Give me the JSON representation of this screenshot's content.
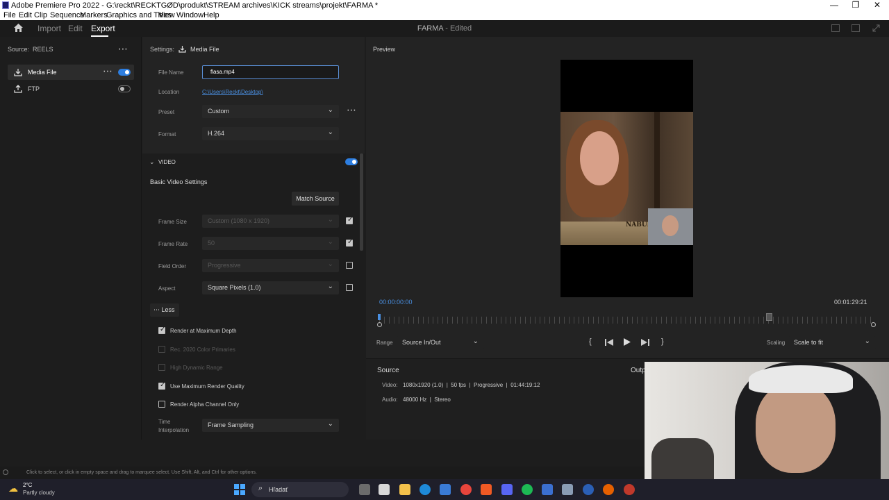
{
  "window": {
    "title": "Adobe Premiere Pro 2022 - G:\\reckt\\RECKTGØD\\produkt\\STREAM archives\\KICK streams\\projekt\\FARMA *",
    "controls": [
      "—",
      "❐",
      "✕"
    ]
  },
  "menu": [
    "File",
    "Edit",
    "Clip",
    "Sequence",
    "Markers",
    "Graphics and Titles",
    "View",
    "Window",
    "Help"
  ],
  "header": {
    "tabs": [
      "Import",
      "Edit",
      "Export"
    ],
    "active_tab": "Export",
    "project": "FARMA",
    "project_status": "- Edited"
  },
  "source_panel": {
    "label": "Source:",
    "value": "REELS",
    "destinations": [
      {
        "name": "Media File",
        "enabled": true
      },
      {
        "name": "FTP",
        "enabled": false
      }
    ]
  },
  "settings": {
    "label": "Settings:",
    "target": "Media File",
    "file_name_label": "File Name",
    "file_name": "flasa.mp4",
    "location_label": "Location",
    "location": "C:\\Users\\Reckt\\Desktop\\",
    "preset_label": "Preset",
    "preset": "Custom",
    "format_label": "Format",
    "format": "H.264"
  },
  "video": {
    "section_label": "VIDEO",
    "basic_title": "Basic Video Settings",
    "match_source": "Match Source",
    "frame_size_label": "Frame Size",
    "frame_size": "Custom (1080 x 1920)",
    "frame_rate_label": "Frame Rate",
    "frame_rate": "50",
    "field_order_label": "Field Order",
    "field_order": "Progressive",
    "aspect_label": "Aspect",
    "aspect": "Square Pixels (1.0)",
    "less_button": "Less",
    "options": [
      {
        "label": "Render at Maximum Depth",
        "checked": true,
        "disabled": false
      },
      {
        "label": "Rec. 2020 Color Primaries",
        "checked": false,
        "disabled": true
      },
      {
        "label": "High Dynamic Range",
        "checked": false,
        "disabled": true
      },
      {
        "label": "Use Maximum Render Quality",
        "checked": true,
        "disabled": false
      },
      {
        "label": "Render Alpha Channel Only",
        "checked": false,
        "disabled": false
      }
    ],
    "time_interp_label_1": "Time",
    "time_interp_label_2": "Interpolation",
    "time_interp": "Frame Sampling"
  },
  "preview": {
    "label": "Preview",
    "timecode_start": "00:00:00:00",
    "timecode_end": "00:01:29:21",
    "range_label": "Range",
    "range": "Source In/Out",
    "scaling_label": "Scaling",
    "scaling": "Scale to fit",
    "overlay_text": "NABUDÚ"
  },
  "source_info": {
    "title": "Source",
    "video_label": "Video:",
    "video": "1080x1920 (1.0)  |  50 fps  |  Progressive  |  01:44:19:12",
    "audio_label": "Audio:",
    "audio": "48000 Hz  |  Stereo",
    "output_label": "Outp"
  },
  "status_bar": {
    "text": "Click to select, or click in empty space and drag to marquee select. Use Shift, Alt, and Ctrl for other options."
  },
  "taskbar": {
    "temp": "2°C",
    "weather": "Partly cloudy",
    "search": "Hľadať"
  },
  "colors": {
    "accent": "#2d7ee0",
    "link": "#4a90e2",
    "panel_bg": "#1d1d1d"
  }
}
